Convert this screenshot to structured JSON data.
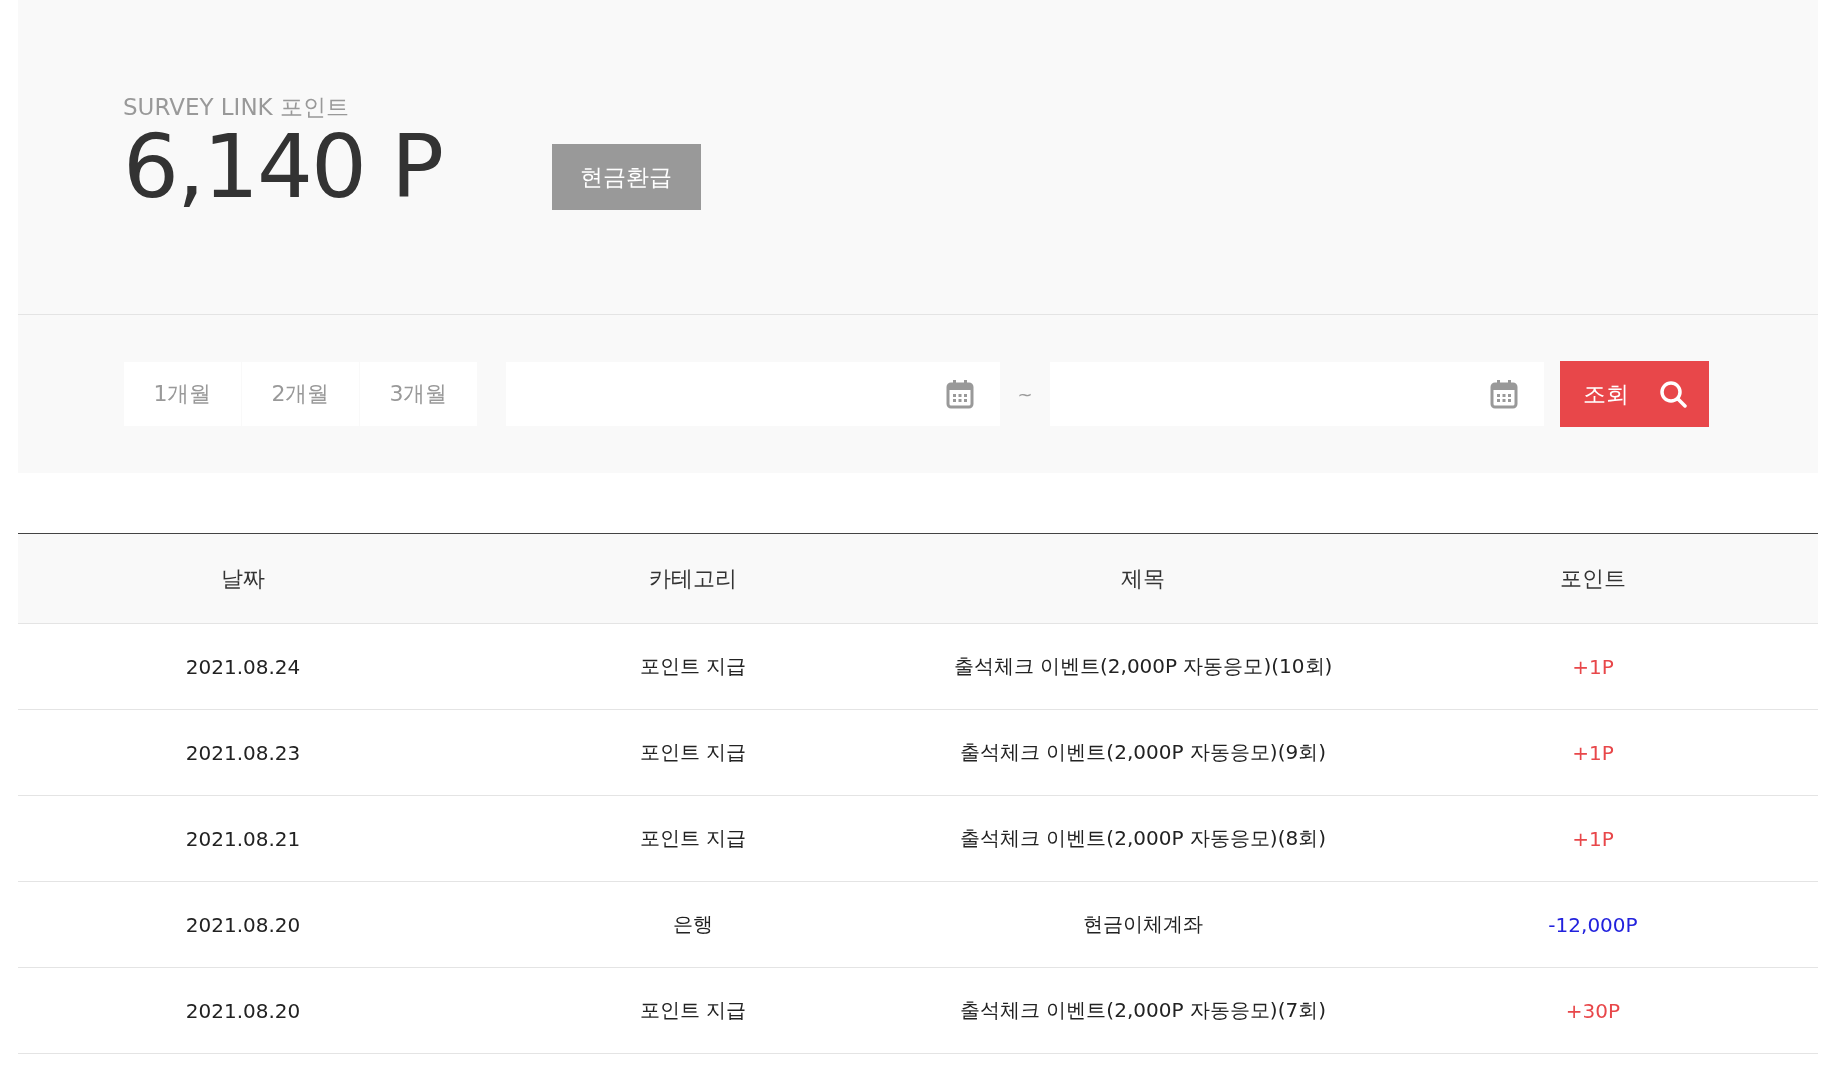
{
  "summary": {
    "label": "SURVEY LINK 포인트",
    "balance": "6,140 P",
    "refund_button": "현금환급"
  },
  "filter": {
    "periods": [
      {
        "label": "1개월",
        "selected": false
      },
      {
        "label": "2개월",
        "selected": false
      },
      {
        "label": "3개월",
        "selected": false
      }
    ],
    "separator": "~",
    "search_button": "조회"
  },
  "table": {
    "columns": [
      "날짜",
      "카테고리",
      "제목",
      "포인트"
    ],
    "rows": [
      {
        "date": "2021.08.24",
        "category": "포인트 지급",
        "title": "출석체크 이벤트(2,000P 자동응모)(10회)",
        "points": "+1P",
        "kind": "earn"
      },
      {
        "date": "2021.08.23",
        "category": "포인트 지급",
        "title": "출석체크 이벤트(2,000P 자동응모)(9회)",
        "points": "+1P",
        "kind": "earn"
      },
      {
        "date": "2021.08.21",
        "category": "포인트 지급",
        "title": "출석체크 이벤트(2,000P 자동응모)(8회)",
        "points": "+1P",
        "kind": "earn"
      },
      {
        "date": "2021.08.20",
        "category": "은행",
        "title": "현금이체계좌",
        "points": "-12,000P",
        "kind": "spend"
      },
      {
        "date": "2021.08.20",
        "category": "포인트 지급",
        "title": "출석체크 이벤트(2,000P 자동응모)(7회)",
        "points": "+30P",
        "kind": "earn"
      }
    ]
  }
}
